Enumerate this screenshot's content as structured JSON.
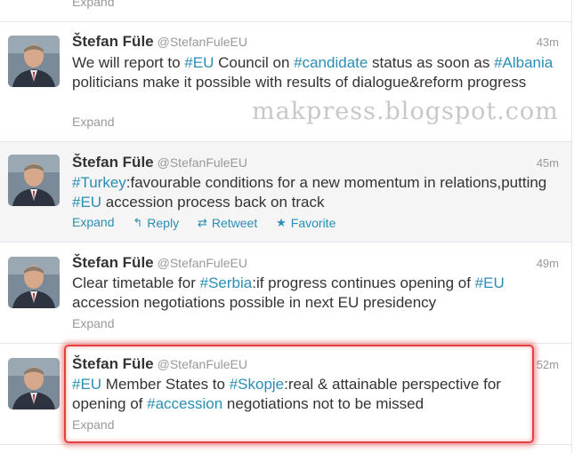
{
  "top_stub": {
    "expand": "Expand"
  },
  "watermark": "makpress.blogspot.com",
  "tweets": [
    {
      "name": "Štefan Füle",
      "handle": "@StefanFuleEU",
      "time": "43m",
      "segments": [
        {
          "t": "We will report to "
        },
        {
          "t": "#EU",
          "tag": true
        },
        {
          "t": " Council on "
        },
        {
          "t": "#candidate",
          "tag": true
        },
        {
          "t": " status as soon as "
        },
        {
          "t": "#Albania",
          "tag": true
        },
        {
          "t": " politicians make it possible with results of dialogue&reform progress"
        }
      ],
      "expand": "Expand"
    },
    {
      "name": "Štefan Füle",
      "handle": "@StefanFuleEU",
      "time": "45m",
      "segments": [
        {
          "t": "#Turkey",
          "tag": true
        },
        {
          "t": ":favourable conditions for a new momentum in relations,putting "
        },
        {
          "t": "#EU",
          "tag": true
        },
        {
          "t": " accession process back on track"
        }
      ],
      "expand": "Expand",
      "actions": {
        "reply": "Reply",
        "retweet": "Retweet",
        "favorite": "Favorite"
      }
    },
    {
      "name": "Štefan Füle",
      "handle": "@StefanFuleEU",
      "time": "49m",
      "segments": [
        {
          "t": "Clear timetable for "
        },
        {
          "t": "#Serbia",
          "tag": true
        },
        {
          "t": ":if progress continues opening of "
        },
        {
          "t": "#EU",
          "tag": true
        },
        {
          "t": " accession negotiations possible in next EU presidency"
        }
      ],
      "expand": "Expand"
    },
    {
      "name": "Štefan Füle",
      "handle": "@StefanFuleEU",
      "time": "52m",
      "segments": [
        {
          "t": "#EU",
          "tag": true
        },
        {
          "t": " Member States to "
        },
        {
          "t": "#Skopje",
          "tag": true
        },
        {
          "t": ":real & attainable perspective for opening of "
        },
        {
          "t": "#accession",
          "tag": true
        },
        {
          "t": " negotiations not to be missed"
        }
      ],
      "expand": "Expand"
    }
  ]
}
